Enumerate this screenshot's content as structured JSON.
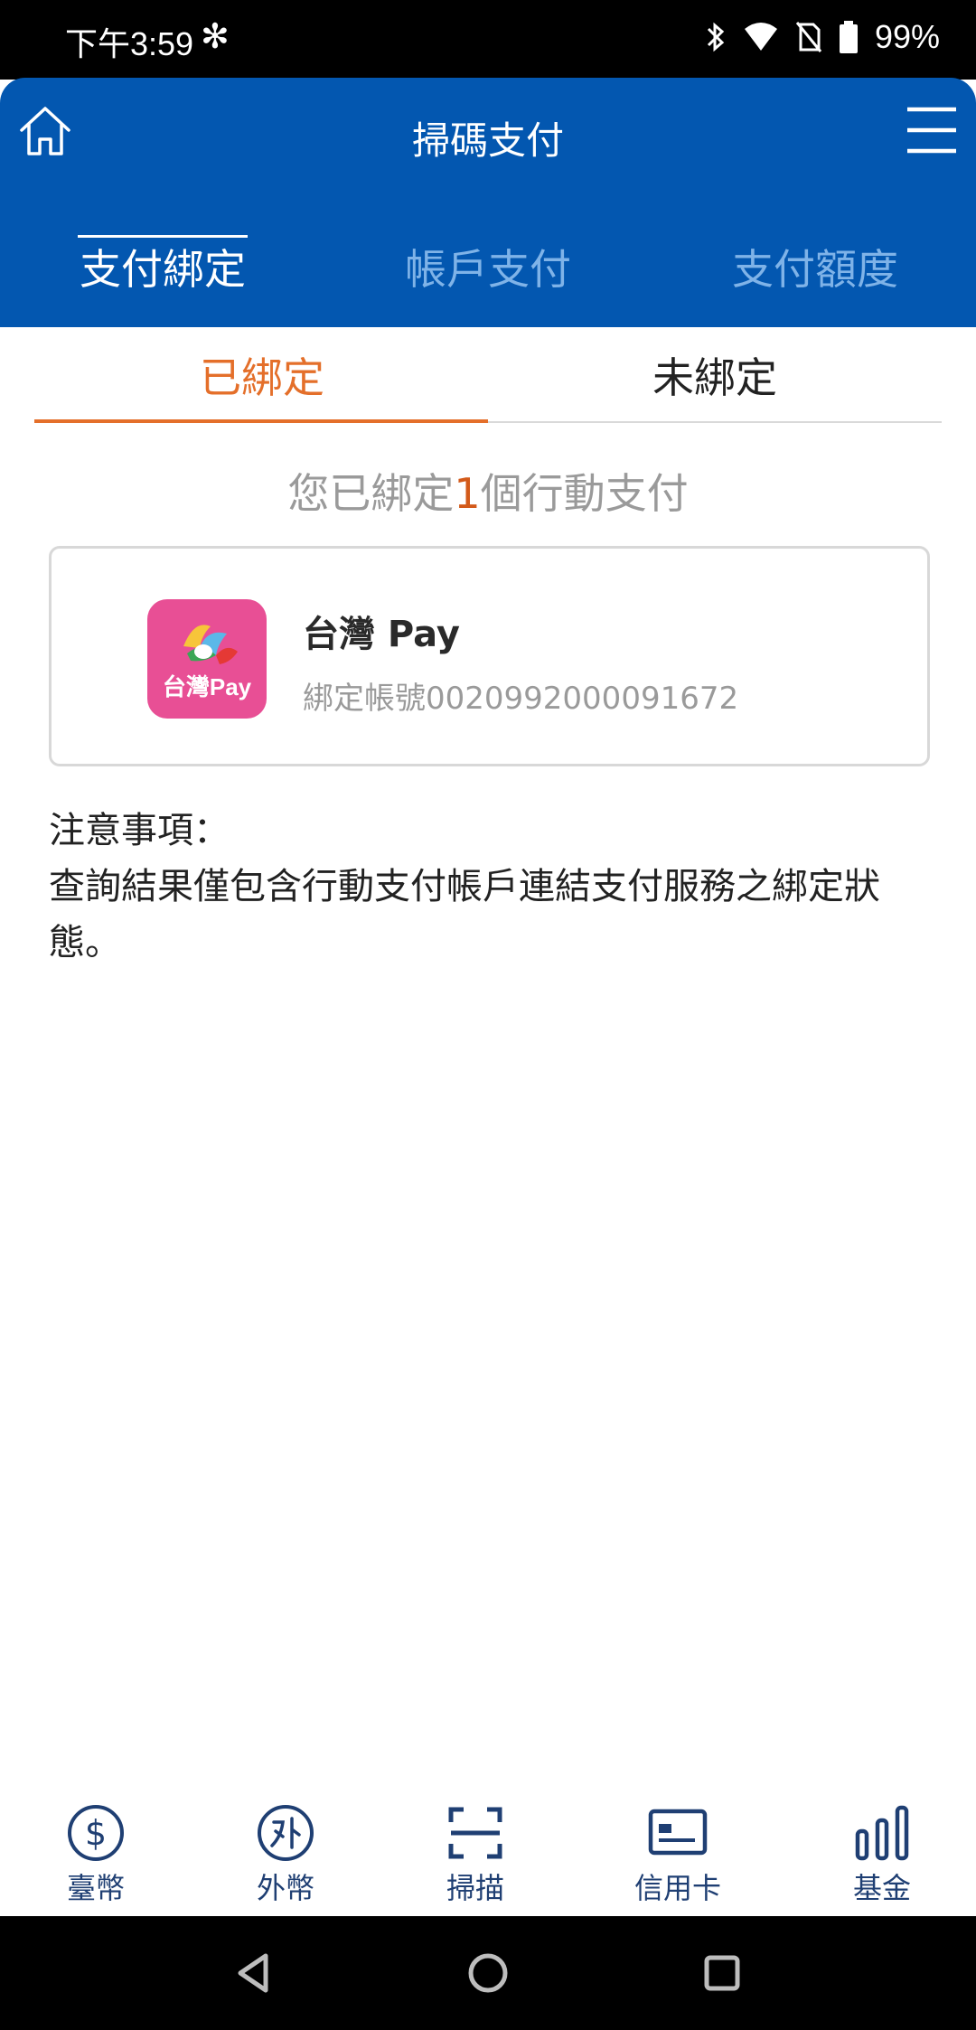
{
  "status_bar": {
    "time": "下午3:59",
    "battery": "99%"
  },
  "header": {
    "title": "掃碼支付",
    "tabs": [
      {
        "label": "支付綁定",
        "active": true
      },
      {
        "label": "帳戶支付",
        "active": false
      },
      {
        "label": "支付額度",
        "active": false
      }
    ]
  },
  "sub_tabs": [
    {
      "label": "已綁定",
      "active": true
    },
    {
      "label": "未綁定",
      "active": false
    }
  ],
  "summary": {
    "prefix": "您已綁定",
    "count": "1",
    "suffix": "個行動支付"
  },
  "card": {
    "logo_text": "台灣Pay",
    "name": "台灣 Pay",
    "account": "綁定帳號0020992000091672"
  },
  "notes": {
    "title": "注意事項：",
    "body": "查詢結果僅包含行動支付帳戶連結支付服務之綁定狀態。"
  },
  "bottom_nav": [
    {
      "label": "臺幣",
      "icon": "dollar-circle-icon"
    },
    {
      "label": "外幣",
      "icon": "foreign-currency-icon"
    },
    {
      "label": "掃描",
      "icon": "scan-icon"
    },
    {
      "label": "信用卡",
      "icon": "credit-card-icon"
    },
    {
      "label": "基金",
      "icon": "bar-chart-icon"
    }
  ],
  "colors": {
    "header_blue": "#0357b0",
    "active_orange": "#e46f2a",
    "inactive_tab_blue": "#7fb3e8",
    "logo_pink": "#e84f95",
    "nav_navy": "#1f3f73"
  }
}
